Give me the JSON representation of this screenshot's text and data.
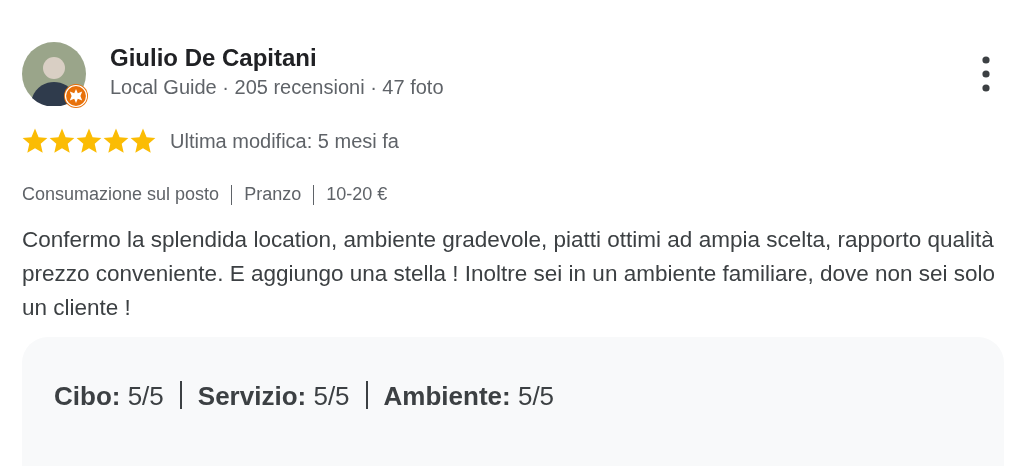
{
  "review": {
    "author": "Giulio De Capitani",
    "author_meta": "Local Guide · 205 recensioni · 47 foto",
    "local_guide": true,
    "stars": 5,
    "date": "Ultima modifica: 5 mesi fa",
    "tags": [
      "Consumazione sul posto",
      "Pranzo",
      "10-20 €"
    ],
    "text": "Confermo la splendida location, ambiente gradevole, piatti ottimi ad ampia scelta, rapporto qualità prezzo conveniente. E aggiungo una stella ! Inoltre sei in un ambiente familiare, dove non sei solo un cliente !",
    "ratings": [
      {
        "label": "Cibo:",
        "value": "5/5"
      },
      {
        "label": "Servizio:",
        "value": "5/5"
      },
      {
        "label": "Ambiente:",
        "value": "5/5"
      }
    ]
  }
}
